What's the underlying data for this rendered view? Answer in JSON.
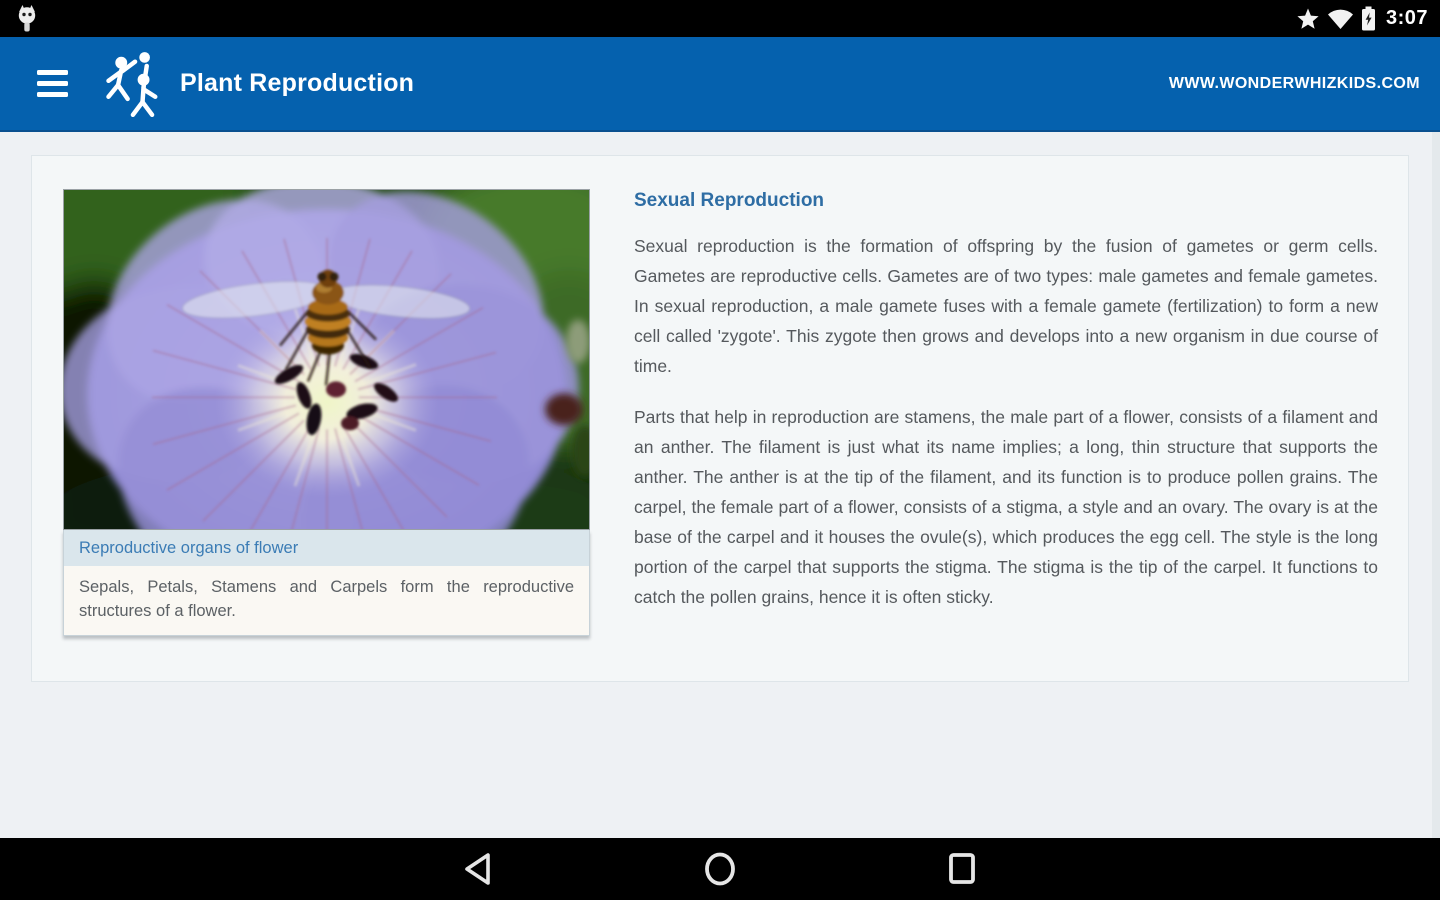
{
  "status_bar": {
    "time": "3:07",
    "icons": [
      "notification-icon",
      "star-icon",
      "wifi-icon",
      "battery-charging-icon"
    ]
  },
  "app_bar": {
    "title": "Plant Reproduction",
    "website": "WWW.WONDERWHIZKIDS.COM",
    "menu_icon": "hamburger-menu-icon",
    "logo_icon": "wonderwhizkids-kids-logo"
  },
  "figure": {
    "caption": "Reproductive organs of flower",
    "description": "Sepals, Petals, Stamens and Carpels form the reproductive structures of a flower.",
    "image_subject": "purple geranium flower with hoverfly"
  },
  "article": {
    "heading": "Sexual Reproduction",
    "paragraphs": [
      "Sexual reproduction is the formation of offspring by the fusion of gametes or germ cells. Gametes are reproductive cells. Gametes are of two types: male gametes and female gametes. In sexual reproduction, a male gamete fuses with a female gamete (fertilization) to form a new cell called 'zygote'. This zygote then grows and develops into a new organism in due course of time.",
      "Parts that help in reproduction are stamens, the male part of a flower, consists of a filament and an anther. The filament is just what its name implies; a long, thin structure that supports the anther. The anther is at the tip of the filament, and its function is to produce pollen grains. The carpel, the female part of a flower, consists of a stigma, a style and an ovary. The ovary is at the base of the carpel and it houses the ovule(s), which produces the egg cell. The style is the long portion of the carpel that supports the stigma. The stigma is the tip of the carpel. It functions to catch the pollen grains, hence it is often sticky."
    ]
  },
  "nav_bar": {
    "buttons": [
      "back",
      "home",
      "recents"
    ]
  },
  "colors": {
    "app_bar_blue": "#0561ae",
    "heading_blue": "#2e6da4",
    "caption_blue": "#3b7cb5",
    "caption_bg": "#dae6ec",
    "desc_bg": "#faf8f3",
    "body_text": "#55595d",
    "page_bg": "#eef1f4",
    "card_bg": "#f4f7f8",
    "status_bar_bg": "#000000",
    "nav_bar_bg": "#000000"
  }
}
